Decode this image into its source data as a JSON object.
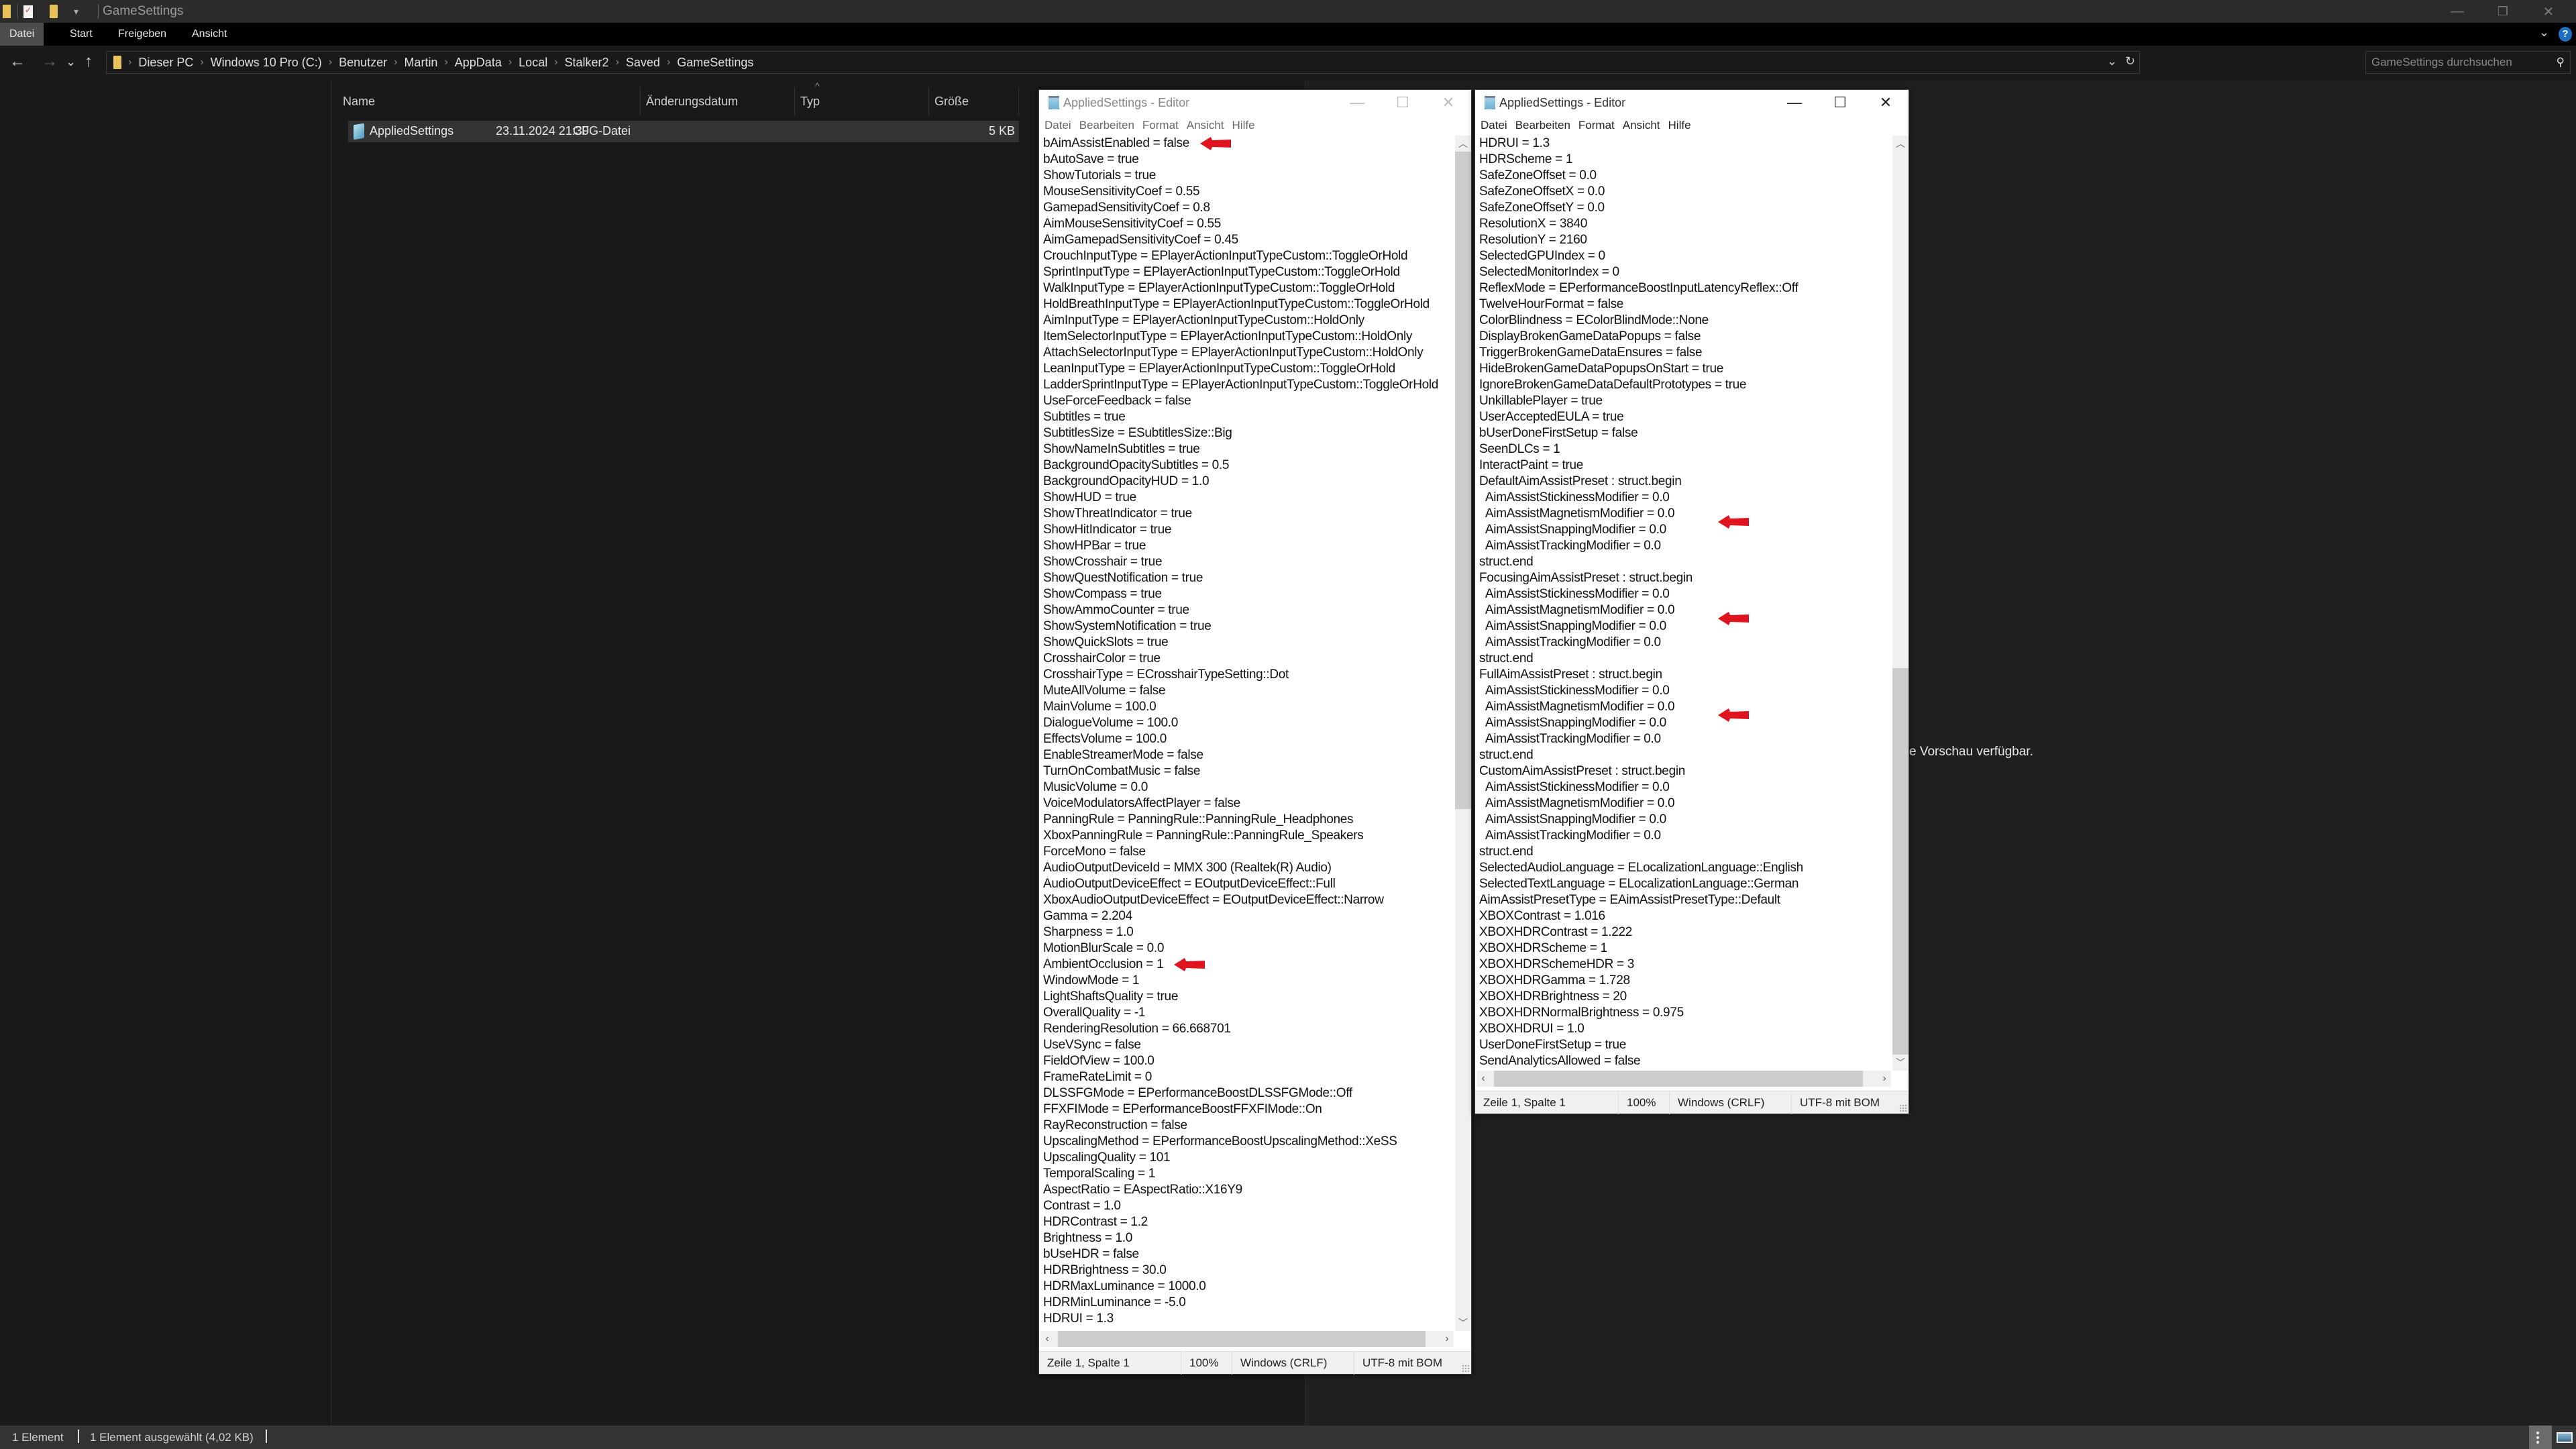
{
  "explorer": {
    "window_title": "GameSettings",
    "ribbon_tabs": [
      "Datei",
      "Start",
      "Freigeben",
      "Ansicht"
    ],
    "breadcrumb": [
      "Dieser PC",
      "Windows 10 Pro (C:)",
      "Benutzer",
      "Martin",
      "AppData",
      "Local",
      "Stalker2",
      "Saved",
      "GameSettings"
    ],
    "search_placeholder": "GameSettings durchsuchen",
    "columns": {
      "name": "Name",
      "date": "Änderungsdatum",
      "type": "Typ",
      "size": "Größe"
    },
    "files": [
      {
        "name": "AppliedSettings",
        "date": "23.11.2024 21:30",
        "type": "CFG-Datei",
        "size": "5 KB",
        "selected": true
      }
    ],
    "preview_message": "e Vorschau verfügbar.",
    "status": {
      "count": "1 Element",
      "selection": "1 Element ausgewählt (4,02 KB)"
    }
  },
  "editor_common": {
    "title": "AppliedSettings - Editor",
    "menu": [
      "Datei",
      "Bearbeiten",
      "Format",
      "Ansicht",
      "Hilfe"
    ],
    "status": {
      "position": "Zeile 1, Spalte 1",
      "zoom": "100%",
      "line_endings": "Windows (CRLF)",
      "encoding": "UTF-8 mit BOM"
    }
  },
  "editor_left": {
    "lines": [
      "bAimAssistEnabled = false",
      "bAutoSave = true",
      "ShowTutorials = true",
      "MouseSensitivityCoef = 0.55",
      "GamepadSensitivityCoef = 0.8",
      "AimMouseSensitivityCoef = 0.55",
      "AimGamepadSensitivityCoef = 0.45",
      "CrouchInputType = EPlayerActionInputTypeCustom::ToggleOrHold",
      "SprintInputType = EPlayerActionInputTypeCustom::ToggleOrHold",
      "WalkInputType = EPlayerActionInputTypeCustom::ToggleOrHold",
      "HoldBreathInputType = EPlayerActionInputTypeCustom::ToggleOrHold",
      "AimInputType = EPlayerActionInputTypeCustom::HoldOnly",
      "ItemSelectorInputType = EPlayerActionInputTypeCustom::HoldOnly",
      "AttachSelectorInputType = EPlayerActionInputTypeCustom::HoldOnly",
      "LeanInputType = EPlayerActionInputTypeCustom::ToggleOrHold",
      "LadderSprintInputType = EPlayerActionInputTypeCustom::ToggleOrHold",
      "UseForceFeedback = false",
      "Subtitles = true",
      "SubtitlesSize = ESubtitlesSize::Big",
      "ShowNameInSubtitles = true",
      "BackgroundOpacitySubtitles = 0.5",
      "BackgroundOpacityHUD = 1.0",
      "ShowHUD = true",
      "ShowThreatIndicator = true",
      "ShowHitIndicator = true",
      "ShowHPBar = true",
      "ShowCrosshair = true",
      "ShowQuestNotification = true",
      "ShowCompass = true",
      "ShowAmmoCounter = true",
      "ShowSystemNotification = true",
      "ShowQuickSlots = true",
      "CrosshairColor = true",
      "CrosshairType = ECrosshairTypeSetting::Dot",
      "MuteAllVolume = false",
      "MainVolume = 100.0",
      "DialogueVolume = 100.0",
      "EffectsVolume = 100.0",
      "EnableStreamerMode = false",
      "TurnOnCombatMusic = false",
      "MusicVolume = 0.0",
      "VoiceModulatorsAffectPlayer = false",
      "PanningRule = PanningRule::PanningRule_Headphones",
      "XboxPanningRule = PanningRule::PanningRule_Speakers",
      "ForceMono = false",
      "AudioOutputDeviceId = MMX 300 (Realtek(R) Audio)",
      "AudioOutputDeviceEffect = EOutputDeviceEffect::Full",
      "XboxAudioOutputDeviceEffect = EOutputDeviceEffect::Narrow",
      "Gamma = 2.204",
      "Sharpness = 1.0",
      "MotionBlurScale = 0.0",
      "AmbientOcclusion = 1",
      "WindowMode = 1",
      "LightShaftsQuality = true",
      "OverallQuality = -1",
      "RenderingResolution = 66.668701",
      "UseVSync = false",
      "FieldOfView = 100.0",
      "FrameRateLimit = 0",
      "DLSSFGMode = EPerformanceBoostDLSSFGMode::Off",
      "FFXFIMode = EPerformanceBoostFFXFIMode::On",
      "RayReconstruction = false",
      "UpscalingMethod = EPerformanceBoostUpscalingMethod::XeSS",
      "UpscalingQuality = 101",
      "TemporalScaling = 1",
      "AspectRatio = EAspectRatio::X16Y9",
      "Contrast = 1.0",
      "HDRContrast = 1.2",
      "Brightness = 1.0",
      "bUseHDR = false",
      "HDRBrightness = 30.0",
      "HDRMaxLuminance = 1000.0",
      "HDRMinLuminance = -5.0",
      "HDRUI = 1.3"
    ],
    "highlighted_lines": [
      0,
      51
    ]
  },
  "editor_right": {
    "lines": [
      "HDRUI = 1.3",
      "HDRScheme = 1",
      "SafeZoneOffset = 0.0",
      "SafeZoneOffsetX = 0.0",
      "SafeZoneOffsetY = 0.0",
      "ResolutionX = 3840",
      "ResolutionY = 2160",
      "SelectedGPUIndex = 0",
      "SelectedMonitorIndex = 0",
      "ReflexMode = EPerformanceBoostInputLatencyReflex::Off",
      "TwelveHourFormat = false",
      "ColorBlindness = EColorBlindMode::None",
      "DisplayBrokenGameDataPopups = false",
      "TriggerBrokenGameDataEnsures = false",
      "HideBrokenGameDataPopupsOnStart = true",
      "IgnoreBrokenGameDataDefaultPrototypes = true",
      "UnkillablePlayer = true",
      "UserAcceptedEULA = true",
      "bUserDoneFirstSetup = false",
      "SeenDLCs = 1",
      "InteractPaint = true",
      "DefaultAimAssistPreset : struct.begin",
      "  AimAssistStickinessModifier = 0.0",
      "  AimAssistMagnetismModifier = 0.0",
      "  AimAssistSnappingModifier = 0.0",
      "  AimAssistTrackingModifier = 0.0",
      "struct.end",
      "FocusingAimAssistPreset : struct.begin",
      "  AimAssistStickinessModifier = 0.0",
      "  AimAssistMagnetismModifier = 0.0",
      "  AimAssistSnappingModifier = 0.0",
      "  AimAssistTrackingModifier = 0.0",
      "struct.end",
      "FullAimAssistPreset : struct.begin",
      "  AimAssistStickinessModifier = 0.0",
      "  AimAssistMagnetismModifier = 0.0",
      "  AimAssistSnappingModifier = 0.0",
      "  AimAssistTrackingModifier = 0.0",
      "struct.end",
      "CustomAimAssistPreset : struct.begin",
      "  AimAssistStickinessModifier = 0.0",
      "  AimAssistMagnetismModifier = 0.0",
      "  AimAssistSnappingModifier = 0.0",
      "  AimAssistTrackingModifier = 0.0",
      "struct.end",
      "SelectedAudioLanguage = ELocalizationLanguage::English",
      "SelectedTextLanguage = ELocalizationLanguage::German",
      "AimAssistPresetType = EAimAssistPresetType::Default",
      "XBOXContrast = 1.016",
      "XBOXHDRContrast = 1.222",
      "XBOXHDRScheme = 1",
      "XBOXHDRSchemeHDR = 3",
      "XBOXHDRGamma = 1.728",
      "XBOXHDRBrightness = 20",
      "XBOXHDRNormalBrightness = 0.975",
      "XBOXHDRUI = 1.0",
      "UserDoneFirstSetup = true",
      "SendAnalyticsAllowed = false"
    ],
    "highlighted_lines": [
      23.5,
      29.5,
      35.5
    ]
  },
  "annotation_color": "#e0141e"
}
